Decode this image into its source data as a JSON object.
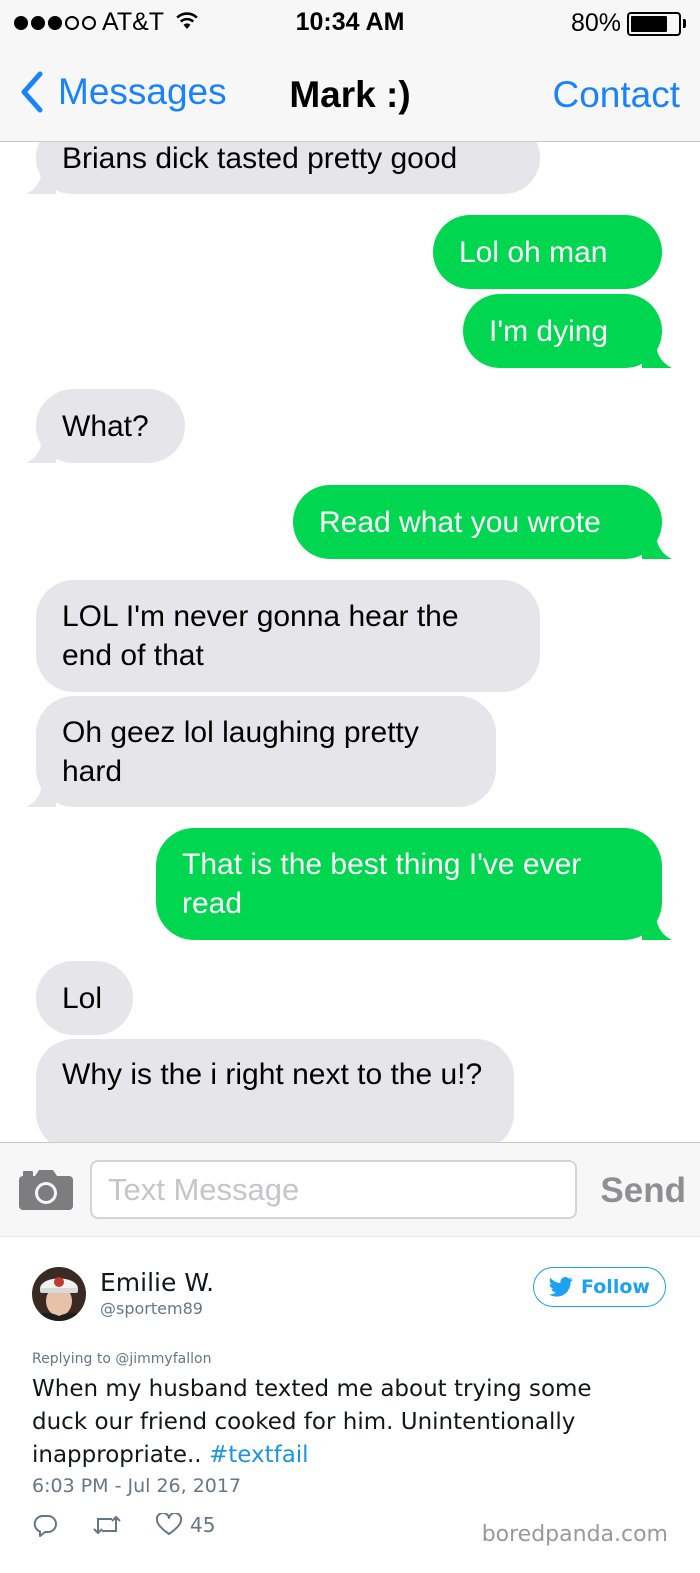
{
  "status_bar": {
    "carrier": "AT&T",
    "signal_bars": 3,
    "signal_total": 5,
    "time": "10:34 AM",
    "battery_percent_label": "80%",
    "battery_level": 0.8
  },
  "nav": {
    "back_label": "Messages",
    "title": "Mark :)",
    "contact_label": "Contact"
  },
  "messages": [
    {
      "from": "received",
      "text": "Brians dick tasted pretty good"
    },
    {
      "from": "sent",
      "text": "Lol oh man"
    },
    {
      "from": "sent",
      "text": "I'm dying"
    },
    {
      "from": "received",
      "text": "What?"
    },
    {
      "from": "sent",
      "text": "Read what you wrote"
    },
    {
      "from": "received",
      "text": "LOL I'm never gonna hear the end of that"
    },
    {
      "from": "received",
      "text": "Oh geez lol laughing pretty hard"
    },
    {
      "from": "sent",
      "text": "That is the best thing I've ever read"
    },
    {
      "from": "received",
      "text": "Lol"
    },
    {
      "from": "received",
      "text": "Why is the i right next to the u!?"
    }
  ],
  "input_bar": {
    "placeholder": "Text Message",
    "send_label": "Send"
  },
  "tweet": {
    "user_name": "Emilie W.",
    "handle": "@sportem89",
    "follow_label": "Follow",
    "replying_to": "Replying to @jimmyfallon",
    "text": "When my husband texted me about trying some duck our friend cooked for him. Unintentionally inappropriate..",
    "hashtag": "#textfail",
    "timestamp": "6:03 PM - Jul 26, 2017",
    "like_count": "45",
    "watermark": "boredpanda.com"
  },
  "colors": {
    "ios_blue": "#1a82fb",
    "sent_bubble": "#00d64f",
    "received_bubble": "#e5e5ea",
    "twitter_blue": "#1da1f2"
  }
}
